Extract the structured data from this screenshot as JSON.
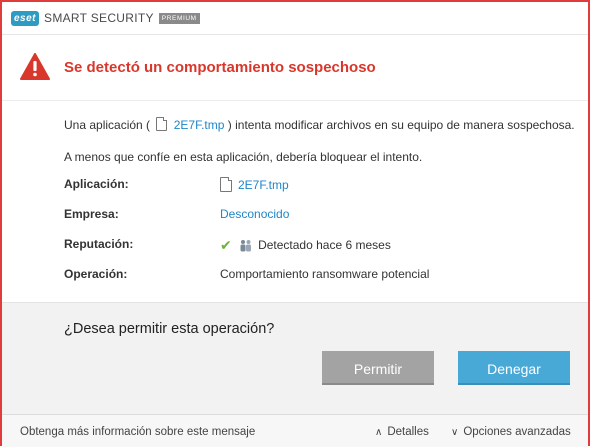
{
  "app": {
    "logo_text": "eset",
    "product_name": "SMART SECURITY",
    "edition": "PREMIUM"
  },
  "alert": {
    "title": "Se detectó un comportamiento sospechoso",
    "accent_color": "#d9372b"
  },
  "message": {
    "line1_prefix": "Una aplicación (",
    "line1_file": "2E7F.tmp",
    "line1_suffix": ") intenta modificar archivos en su equipo de manera sospechosa.",
    "line2": "A menos que confíe en esta aplicación, debería bloquear el intento."
  },
  "details": [
    {
      "label": "Aplicación:",
      "value": "2E7F.tmp"
    },
    {
      "label": "Empresa:",
      "value": "Desconocido"
    },
    {
      "label": "Reputación:",
      "value": "Detectado hace 6 meses"
    },
    {
      "label": "Operación:",
      "value": "Comportamiento ransomware potencial"
    }
  ],
  "question": "¿Desea permitir esta operación?",
  "buttons": {
    "allow": "Permitir",
    "deny": "Denegar"
  },
  "footer": {
    "more_info": "Obtenga más información sobre este mensaje",
    "details": "Detalles",
    "advanced": "Opciones avanzadas"
  },
  "icons": {
    "alert": "warning-triangle-icon",
    "file": "file-icon",
    "reputation_ok": "checkmark-icon",
    "users": "users-icon",
    "close": "close-icon",
    "chevron_up": "chevron-up-icon",
    "chevron_down": "chevron-down-icon"
  }
}
